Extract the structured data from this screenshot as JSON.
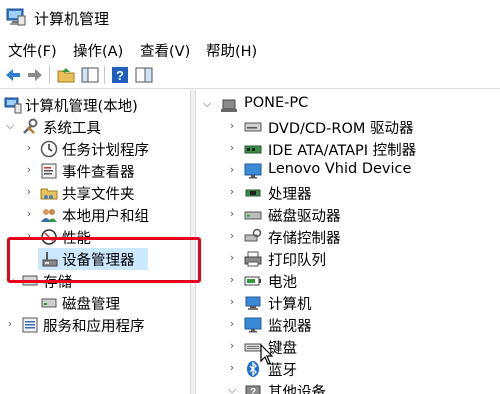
{
  "window": {
    "title": "计算机管理"
  },
  "menu": [
    "文件(F)",
    "操作(A)",
    "查看(V)",
    "帮助(H)"
  ],
  "left_tree": {
    "root": "计算机管理(本地)",
    "system_tools": "系统工具",
    "items": [
      "任务计划程序",
      "事件查看器",
      "共享文件夹",
      "本地用户和组",
      "性能",
      "设备管理器"
    ],
    "storage": "存储",
    "storage_items": [
      "磁盘管理"
    ],
    "services": "服务和应用程序"
  },
  "right_tree": {
    "root": "PONE-PC",
    "items": [
      "DVD/CD-ROM 驱动器",
      "IDE ATA/ATAPI 控制器",
      "Lenovo Vhid Device",
      "处理器",
      "磁盘驱动器",
      "存储控制器",
      "打印队列",
      "电池",
      "计算机",
      "监视器",
      "键盘",
      "蓝牙",
      "其他设备"
    ]
  },
  "colors": {
    "highlight": "#e8001c",
    "selection": "#cce8ff"
  }
}
